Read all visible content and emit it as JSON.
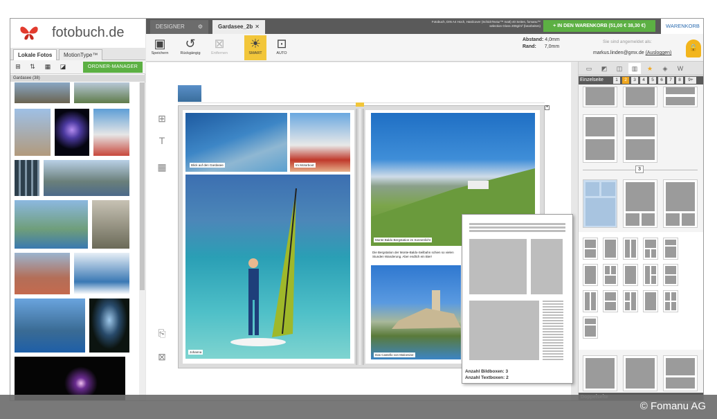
{
  "app": {
    "brand": "fotobuch.de"
  },
  "left": {
    "tabs": [
      "Lokale Fotos",
      "MotionType™"
    ],
    "ordner_label": "ORDNER-MANAGER",
    "folder_label": "Gardasee (38)"
  },
  "top": {
    "designer_tab": "DESIGNER",
    "project_tab": "Gardasee_2b",
    "product_info": "Fotobuch, DIN A4 Hoch, Hardcover (SchickTextur™ matt) 40 Seiten, fomanu™ selection Gloss 200g/m² (bearbeiten)",
    "cart_button": "+ IN DEN WARENKORB (51,00 € 38,30 €)",
    "cart_link": "WARENKORB"
  },
  "toolbar": {
    "save": "Speichern",
    "undo": "Rückgängig",
    "remove": "Entfernen",
    "smart": "SMART",
    "auto": "AUTO",
    "abstand_label": "Abstand:",
    "abstand_value": "4,0mm",
    "rand_label": "Rand:",
    "rand_value": "7,0mm"
  },
  "user": {
    "logged_in": "Sie sind angemeldet als:",
    "email": "markus.linden@gmx.de",
    "logout": "(Ausloggen)"
  },
  "book": {
    "captions": [
      "Blick auf den Gardasee",
      "Im Motorboot",
      "Johanna",
      "Monte Baldo Bergstation im Sonnenlicht",
      "Die Bergstation der Monte-Baldo-Seilbahn schien so vielen Stunden Wanderung. Aber endlich ein Bier!",
      "Das Castello von Malcesine"
    ]
  },
  "popup": {
    "bildboxen": "Anzahl Bildboxen: 3",
    "textboxen": "Anzahl Textboxen: 2"
  },
  "right": {
    "einzelseite": "Einzelseite",
    "pages": [
      "1",
      "2",
      "3",
      "4",
      "5",
      "6",
      "7",
      "8",
      "9+"
    ],
    "section_num": "3",
    "doppelseite": "Doppelseite"
  },
  "copyright": "© Fomanu AG",
  "colors": {
    "accent_green": "#5cb043",
    "accent_orange": "#f0a71f",
    "lock_yellow": "#f2b51d"
  }
}
